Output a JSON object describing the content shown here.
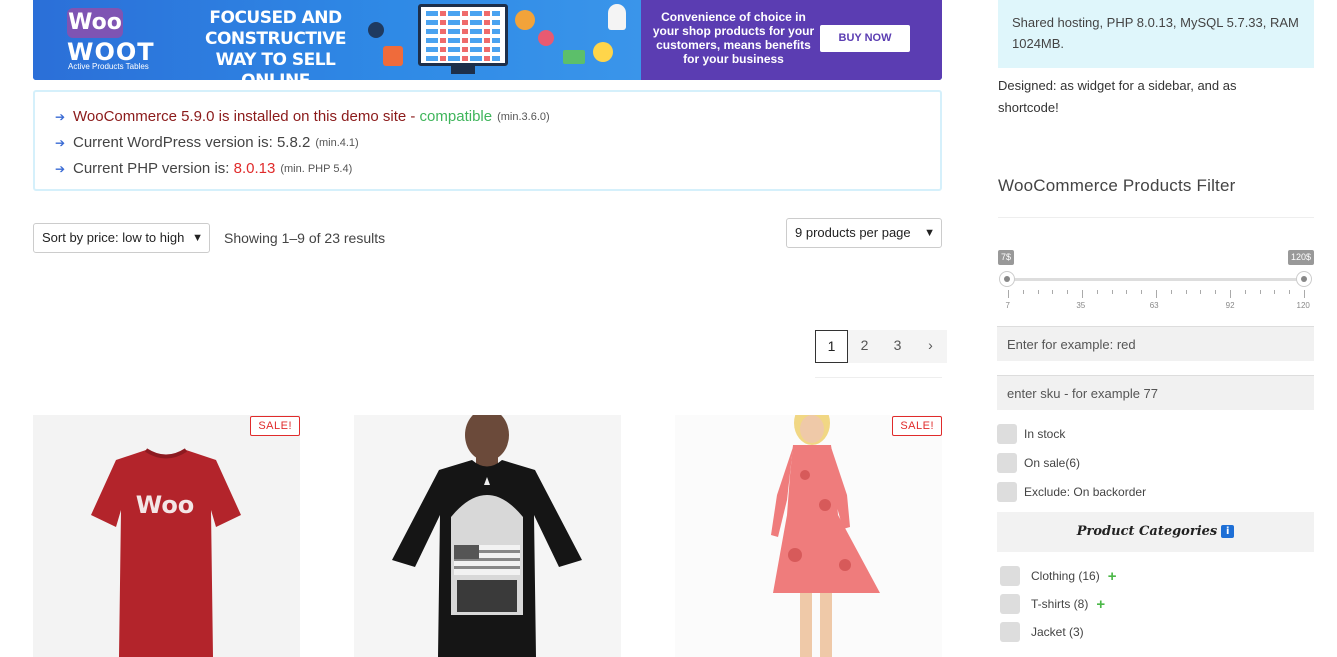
{
  "banner": {
    "logo_woo": "Woo",
    "logo_woot": "WOOT",
    "logo_sub": "Active Products Tables",
    "headline": "FOCUSED AND CONSTRUCTIVE WAY TO SELL ONLINE",
    "right_text": "Convenience of choice in your shop products for your customers, means benefits for your business",
    "buy_label": "BUY NOW",
    "colors": {
      "blue": "#2c6ed6",
      "purple": "#5b3db2"
    }
  },
  "info": {
    "line1_prefix": "WooCommerce 5.9.0 is installed on this demo site - ",
    "line1_status": "compatible",
    "line1_min": "(min.3.6.0)",
    "line2_prefix": "Current WordPress version is: 5.8.2",
    "line2_min": "(min.4.1)",
    "line3_prefix": "Current PHP version is: ",
    "line3_version": "8.0.13",
    "line3_min": "(min. PHP 5.4)"
  },
  "toolbar": {
    "sort_value": "Sort by price: low to high",
    "results": "Showing 1–9 of 23 results",
    "per_page_value": "9 products per page"
  },
  "pagination": {
    "pages": [
      "1",
      "2",
      "3"
    ],
    "next": "›",
    "active": "1"
  },
  "products": [
    {
      "sale_label": "SALE!",
      "shirt_text": "Woo"
    },
    {
      "sale_label": ""
    },
    {
      "sale_label": "SALE!"
    }
  ],
  "sidebar": {
    "host_text": "Shared hosting, PHP 8.0.13, MySQL 5.7.33, RAM 1024MB.",
    "designed_text": "Designed: as widget for a sidebar, and as shortcode!",
    "filter_title": "WooCommerce Products Filter",
    "price_min_tag": "7$",
    "price_max_tag": "120$",
    "price_range": {
      "min": 7,
      "max": 120
    },
    "tick_labels": [
      "7",
      "35",
      "63",
      "92",
      "120"
    ],
    "text_placeholder": "Enter for example: red",
    "sku_placeholder": "enter sku - for example 77",
    "checks": [
      "In stock",
      "On sale(6)",
      "Exclude: On backorder"
    ],
    "categories_title": "Product Categories",
    "categories": [
      {
        "label": "Clothing (16)",
        "expandable": true
      },
      {
        "label": "T-shirts (8)",
        "expandable": true
      },
      {
        "label": "Jacket (3)",
        "expandable": false
      }
    ]
  }
}
